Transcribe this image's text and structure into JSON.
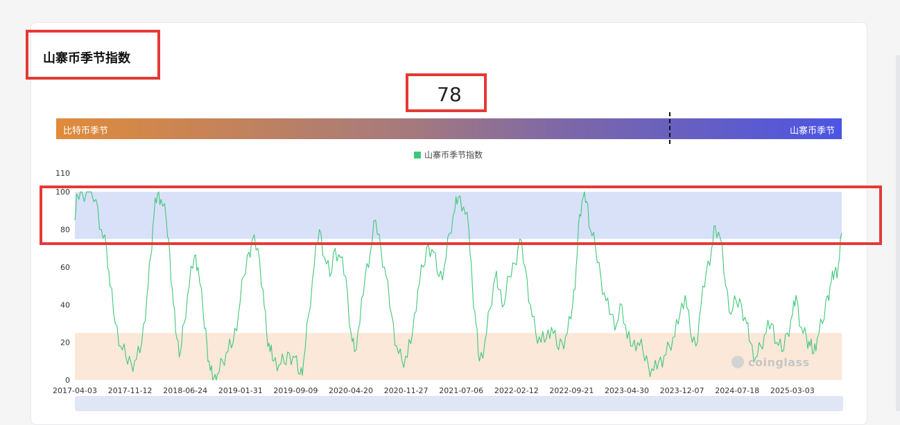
{
  "page": {
    "title": "山寨币季节指数"
  },
  "current_value": "78",
  "gradient_bar": {
    "left_label": "比特币季节",
    "right_label": "山寨币季节",
    "marker_value": 78,
    "left_color": "#e08b3a",
    "right_color": "#4c55e3"
  },
  "watermark": "coinglass",
  "chart_data": {
    "type": "line",
    "series": [
      {
        "name": "山寨币季节指数",
        "color": "#3ec77a",
        "values": [
          [
            0,
            85
          ],
          [
            0.15,
            98
          ],
          [
            0.4,
            100
          ],
          [
            0.8,
            100
          ],
          [
            1.2,
            96
          ],
          [
            1.5,
            80
          ],
          [
            1.8,
            70
          ],
          [
            2.0,
            50
          ],
          [
            2.3,
            30
          ],
          [
            2.6,
            18
          ],
          [
            2.9,
            12
          ],
          [
            3.2,
            9
          ],
          [
            3.5,
            11
          ],
          [
            3.8,
            20
          ],
          [
            4.1,
            45
          ],
          [
            4.3,
            65
          ],
          [
            4.5,
            88
          ],
          [
            4.7,
            99
          ],
          [
            4.9,
            96
          ],
          [
            5.2,
            85
          ],
          [
            5.4,
            66
          ],
          [
            5.6,
            40
          ],
          [
            5.8,
            22
          ],
          [
            6.0,
            15
          ],
          [
            6.2,
            30
          ],
          [
            6.5,
            50
          ],
          [
            6.8,
            66
          ],
          [
            7.0,
            60
          ],
          [
            7.3,
            35
          ],
          [
            7.5,
            20
          ],
          [
            7.7,
            5
          ],
          [
            7.9,
            1
          ],
          [
            8.1,
            3
          ],
          [
            8.4,
            10
          ],
          [
            8.7,
            15
          ],
          [
            9.0,
            20
          ],
          [
            9.3,
            35
          ],
          [
            9.6,
            55
          ],
          [
            9.9,
            68
          ],
          [
            10.1,
            75
          ],
          [
            10.4,
            70
          ],
          [
            10.7,
            48
          ],
          [
            10.9,
            25
          ],
          [
            11.1,
            15
          ],
          [
            11.3,
            10
          ],
          [
            11.6,
            8
          ],
          [
            11.9,
            9
          ],
          [
            12.2,
            14
          ],
          [
            12.5,
            12
          ],
          [
            12.8,
            3
          ],
          [
            13.0,
            10
          ],
          [
            13.3,
            35
          ],
          [
            13.6,
            60
          ],
          [
            13.9,
            80
          ],
          [
            14.2,
            65
          ],
          [
            14.5,
            55
          ],
          [
            14.8,
            70
          ],
          [
            15.1,
            65
          ],
          [
            15.4,
            55
          ],
          [
            15.7,
            25
          ],
          [
            15.9,
            15
          ],
          [
            16.2,
            30
          ],
          [
            16.5,
            55
          ],
          [
            16.8,
            68
          ],
          [
            17.1,
            85
          ],
          [
            17.4,
            70
          ],
          [
            17.7,
            55
          ],
          [
            18.0,
            35
          ],
          [
            18.3,
            18
          ],
          [
            18.6,
            10
          ],
          [
            18.9,
            12
          ],
          [
            19.2,
            25
          ],
          [
            19.5,
            48
          ],
          [
            19.8,
            60
          ],
          [
            20.1,
            72
          ],
          [
            20.4,
            68
          ],
          [
            20.7,
            55
          ],
          [
            21.0,
            60
          ],
          [
            21.3,
            78
          ],
          [
            21.6,
            90
          ],
          [
            21.8,
            97
          ],
          [
            22.1,
            92
          ],
          [
            22.4,
            80
          ],
          [
            22.6,
            50
          ],
          [
            22.8,
            30
          ],
          [
            23.0,
            10
          ],
          [
            23.3,
            20
          ],
          [
            23.6,
            38
          ],
          [
            23.9,
            55
          ],
          [
            24.1,
            48
          ],
          [
            24.4,
            40
          ],
          [
            24.7,
            55
          ],
          [
            25.0,
            62
          ],
          [
            25.3,
            75
          ],
          [
            25.6,
            60
          ],
          [
            25.9,
            40
          ],
          [
            26.2,
            25
          ],
          [
            26.5,
            20
          ],
          [
            26.8,
            22
          ],
          [
            27.1,
            28
          ],
          [
            27.4,
            18
          ],
          [
            27.7,
            20
          ],
          [
            28.0,
            25
          ],
          [
            28.3,
            40
          ],
          [
            28.5,
            60
          ],
          [
            28.7,
            88
          ],
          [
            28.9,
            97
          ],
          [
            29.1,
            95
          ],
          [
            29.3,
            80
          ],
          [
            29.6,
            70
          ],
          [
            29.9,
            55
          ],
          [
            30.2,
            42
          ],
          [
            30.5,
            35
          ],
          [
            30.8,
            30
          ],
          [
            31.1,
            40
          ],
          [
            31.4,
            22
          ],
          [
            31.7,
            18
          ],
          [
            32.0,
            20
          ],
          [
            32.3,
            15
          ],
          [
            32.6,
            8
          ],
          [
            32.9,
            5
          ],
          [
            33.2,
            10
          ],
          [
            33.5,
            13
          ],
          [
            33.8,
            18
          ],
          [
            34.1,
            23
          ],
          [
            34.4,
            35
          ],
          [
            34.7,
            45
          ],
          [
            35.0,
            25
          ],
          [
            35.3,
            18
          ],
          [
            35.6,
            40
          ],
          [
            35.9,
            58
          ],
          [
            36.2,
            70
          ],
          [
            36.4,
            82
          ],
          [
            36.7,
            75
          ],
          [
            37.0,
            50
          ],
          [
            37.3,
            35
          ],
          [
            37.6,
            42
          ],
          [
            37.9,
            40
          ],
          [
            38.2,
            30
          ],
          [
            38.4,
            20
          ],
          [
            38.7,
            12
          ],
          [
            39.0,
            18
          ],
          [
            39.3,
            25
          ],
          [
            39.6,
            30
          ],
          [
            39.9,
            20
          ],
          [
            40.2,
            15
          ],
          [
            40.5,
            25
          ],
          [
            40.8,
            35
          ],
          [
            41.0,
            45
          ],
          [
            41.3,
            28
          ],
          [
            41.6,
            22
          ],
          [
            41.8,
            18
          ],
          [
            42.0,
            14
          ],
          [
            42.2,
            22
          ],
          [
            42.5,
            30
          ],
          [
            42.8,
            45
          ],
          [
            43.0,
            52
          ],
          [
            43.2,
            58
          ],
          [
            43.4,
            60
          ],
          [
            43.6,
            78
          ]
        ]
      }
    ],
    "x_ticks": [
      "2017-04-03",
      "2017-11-12",
      "2018-06-24",
      "2019-01-31",
      "2019-09-09",
      "2020-04-20",
      "2020-11-27",
      "2021-07-06",
      "2022-02-12",
      "2022-09-21",
      "2023-04-30",
      "2023-12-07",
      "2024-07-18",
      "2025-03-03"
    ],
    "ylim": [
      0,
      110
    ],
    "y_ticks": [
      0,
      20,
      40,
      60,
      80,
      100,
      110
    ],
    "bands": [
      {
        "from": 75,
        "to": 100,
        "color": "#d9e1f8"
      },
      {
        "from": 0,
        "to": 25,
        "color": "#fbe8d8"
      }
    ],
    "legend_position": "top-center",
    "grid": false
  }
}
